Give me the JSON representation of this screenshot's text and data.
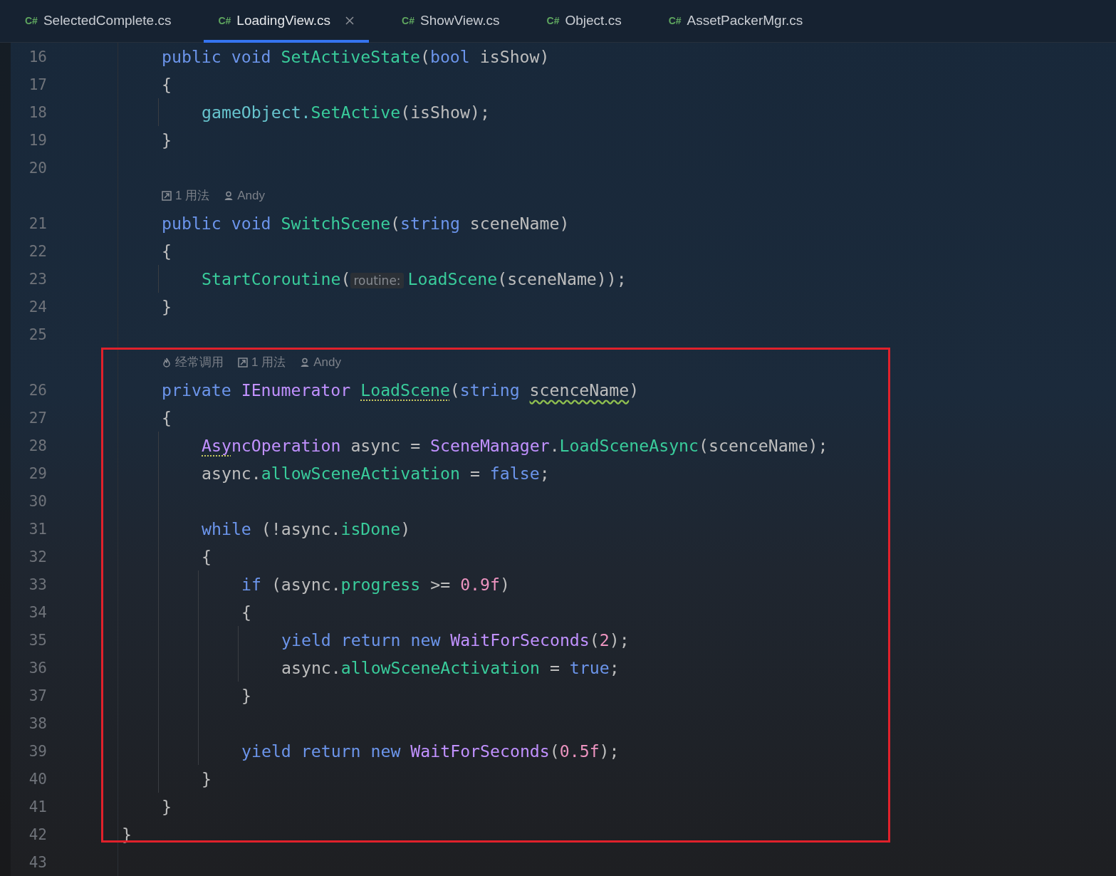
{
  "tabs": [
    {
      "lang": "C#",
      "label": "SelectedComplete.cs",
      "selected": false
    },
    {
      "lang": "C#",
      "label": "LoadingView.cs",
      "selected": true
    },
    {
      "lang": "C#",
      "label": "ShowView.cs",
      "selected": false
    },
    {
      "lang": "C#",
      "label": "Object.cs",
      "selected": false
    },
    {
      "lang": "C#",
      "label": "AssetPackerMgr.cs",
      "selected": false
    }
  ],
  "rows": [
    {
      "kind": "block",
      "children": [
        {
          "kind": "code",
          "number": "16",
          "tokens": [
            {
              "kind": "kw",
              "text": "public"
            },
            {
              "kind": "kw",
              "text": " void"
            },
            {
              "kind": "method",
              "text": " SetActiveState"
            },
            {
              "kind": "plain",
              "text": "("
            },
            {
              "kind": "kw",
              "text": "bool"
            },
            {
              "kind": "plain",
              "text": " isShow)"
            }
          ]
        },
        {
          "kind": "code",
          "number": "17",
          "tokens": [
            {
              "kind": "plain",
              "text": "{"
            }
          ]
        },
        {
          "kind": "block",
          "children": [
            {
              "kind": "code",
              "number": "18",
              "tokens": [
                {
                  "kind": "field",
                  "text": "gameObject."
                },
                {
                  "kind": "method",
                  "text": "SetActive"
                },
                {
                  "kind": "plain",
                  "text": "(isShow);"
                }
              ]
            }
          ]
        },
        {
          "kind": "code",
          "number": "19",
          "tokens": [
            {
              "kind": "plain",
              "text": "}"
            }
          ]
        },
        {
          "kind": "code",
          "number": "20"
        },
        {
          "kind": "hints",
          "items": [
            {
              "kind": "usages",
              "text": "1 用法"
            },
            {
              "kind": "author",
              "text": "Andy"
            }
          ]
        },
        {
          "kind": "code",
          "number": "21",
          "tokens": [
            {
              "kind": "kw",
              "text": "public"
            },
            {
              "kind": "kw",
              "text": " void"
            },
            {
              "kind": "method",
              "text": " SwitchScene"
            },
            {
              "kind": "plain",
              "text": "("
            },
            {
              "kind": "kw",
              "text": "string"
            },
            {
              "kind": "plain",
              "text": " sceneName)"
            }
          ]
        },
        {
          "kind": "code",
          "number": "22",
          "tokens": [
            {
              "kind": "plain",
              "text": "{"
            }
          ]
        },
        {
          "kind": "block",
          "children": [
            {
              "kind": "code",
              "number": "23",
              "tokens": [
                {
                  "kind": "method",
                  "text": "StartCoroutine"
                },
                {
                  "kind": "plain",
                  "text": "("
                },
                {
                  "kind": "param_hint",
                  "text": "routine:"
                },
                {
                  "kind": "method",
                  "text": "LoadScene"
                },
                {
                  "kind": "plain",
                  "text": "(sceneName));"
                }
              ]
            }
          ]
        },
        {
          "kind": "code",
          "number": "24",
          "tokens": [
            {
              "kind": "plain",
              "text": "}"
            }
          ]
        },
        {
          "kind": "code",
          "number": "25"
        },
        {
          "kind": "hints",
          "items": [
            {
              "kind": "frequent",
              "text": "经常调用"
            },
            {
              "kind": "usages",
              "text": "1 用法"
            },
            {
              "kind": "author",
              "text": "Andy"
            }
          ]
        },
        {
          "kind": "code",
          "number": "26",
          "tokens": [
            {
              "kind": "kw",
              "text": "private"
            },
            {
              "kind": "type",
              "text": " IEnumerator "
            },
            {
              "kind": "method",
              "text": "LoadScene",
              "dotted_underline": true
            },
            {
              "kind": "plain",
              "text": "("
            },
            {
              "kind": "kw",
              "text": "string "
            },
            {
              "kind": "plain",
              "text": "scenceName",
              "wavy_underline": true
            },
            {
              "kind": "plain",
              "text": ")"
            }
          ]
        },
        {
          "kind": "code",
          "number": "27",
          "tokens": [
            {
              "kind": "plain",
              "text": "{"
            }
          ]
        },
        {
          "kind": "block",
          "children": [
            {
              "kind": "code",
              "number": "28",
              "tokens": [
                {
                  "kind": "type",
                  "text": "Asy",
                  "dotted_underline": true
                },
                {
                  "kind": "type",
                  "text": "ncOperation"
                },
                {
                  "kind": "plain",
                  "text": " async = "
                },
                {
                  "kind": "type",
                  "text": "SceneManager"
                },
                {
                  "kind": "plain",
                  "text": "."
                },
                {
                  "kind": "method",
                  "text": "LoadSceneAsync"
                },
                {
                  "kind": "plain",
                  "text": "(scenceName);"
                }
              ]
            },
            {
              "kind": "code",
              "number": "29",
              "tokens": [
                {
                  "kind": "plain",
                  "text": "async."
                },
                {
                  "kind": "method",
                  "text": "allowSceneActivation"
                },
                {
                  "kind": "plain",
                  "text": " = "
                },
                {
                  "kind": "kw",
                  "text": "false"
                },
                {
                  "kind": "plain",
                  "text": ";"
                }
              ]
            },
            {
              "kind": "code",
              "number": "30"
            },
            {
              "kind": "code",
              "number": "31",
              "tokens": [
                {
                  "kind": "kw",
                  "text": "while"
                },
                {
                  "kind": "plain",
                  "text": " (!async."
                },
                {
                  "kind": "method",
                  "text": "isDone"
                },
                {
                  "kind": "plain",
                  "text": ")"
                }
              ]
            },
            {
              "kind": "code",
              "number": "32",
              "tokens": [
                {
                  "kind": "plain",
                  "text": "{"
                }
              ]
            },
            {
              "kind": "block",
              "children": [
                {
                  "kind": "code",
                  "number": "33",
                  "tokens": [
                    {
                      "kind": "kw",
                      "text": "if"
                    },
                    {
                      "kind": "plain",
                      "text": " (async."
                    },
                    {
                      "kind": "method",
                      "text": "progress"
                    },
                    {
                      "kind": "plain",
                      "text": " >= "
                    },
                    {
                      "kind": "num",
                      "text": "0.9f"
                    },
                    {
                      "kind": "plain",
                      "text": ")"
                    }
                  ]
                },
                {
                  "kind": "code",
                  "number": "34",
                  "tokens": [
                    {
                      "kind": "plain",
                      "text": "{"
                    }
                  ]
                },
                {
                  "kind": "block",
                  "children": [
                    {
                      "kind": "code",
                      "number": "35",
                      "tokens": [
                        {
                          "kind": "kw",
                          "text": "yield return new"
                        },
                        {
                          "kind": "type",
                          "text": " WaitForSeconds"
                        },
                        {
                          "kind": "plain",
                          "text": "("
                        },
                        {
                          "kind": "num",
                          "text": "2"
                        },
                        {
                          "kind": "plain",
                          "text": ");"
                        }
                      ]
                    },
                    {
                      "kind": "code",
                      "number": "36",
                      "tokens": [
                        {
                          "kind": "plain",
                          "text": "async."
                        },
                        {
                          "kind": "method",
                          "text": "allowSceneActivation"
                        },
                        {
                          "kind": "plain",
                          "text": " = "
                        },
                        {
                          "kind": "kw",
                          "text": "true"
                        },
                        {
                          "kind": "plain",
                          "text": ";"
                        }
                      ]
                    }
                  ]
                },
                {
                  "kind": "code",
                  "number": "37",
                  "tokens": [
                    {
                      "kind": "plain",
                      "text": "}"
                    }
                  ]
                },
                {
                  "kind": "code",
                  "number": "38"
                },
                {
                  "kind": "code",
                  "number": "39",
                  "tokens": [
                    {
                      "kind": "kw",
                      "text": "yield return new"
                    },
                    {
                      "kind": "type",
                      "text": " WaitForSeconds"
                    },
                    {
                      "kind": "plain",
                      "text": "("
                    },
                    {
                      "kind": "num",
                      "text": "0.5f"
                    },
                    {
                      "kind": "plain",
                      "text": ");"
                    }
                  ]
                }
              ]
            },
            {
              "kind": "code",
              "number": "40",
              "tokens": [
                {
                  "kind": "plain",
                  "text": "}"
                }
              ]
            }
          ]
        },
        {
          "kind": "code",
          "number": "41",
          "tokens": [
            {
              "kind": "plain",
              "text": "}"
            }
          ]
        }
      ]
    },
    {
      "kind": "code",
      "number": "42",
      "tokens": [
        {
          "kind": "plain",
          "text": "}"
        }
      ]
    },
    {
      "kind": "code",
      "number": "43"
    }
  ]
}
